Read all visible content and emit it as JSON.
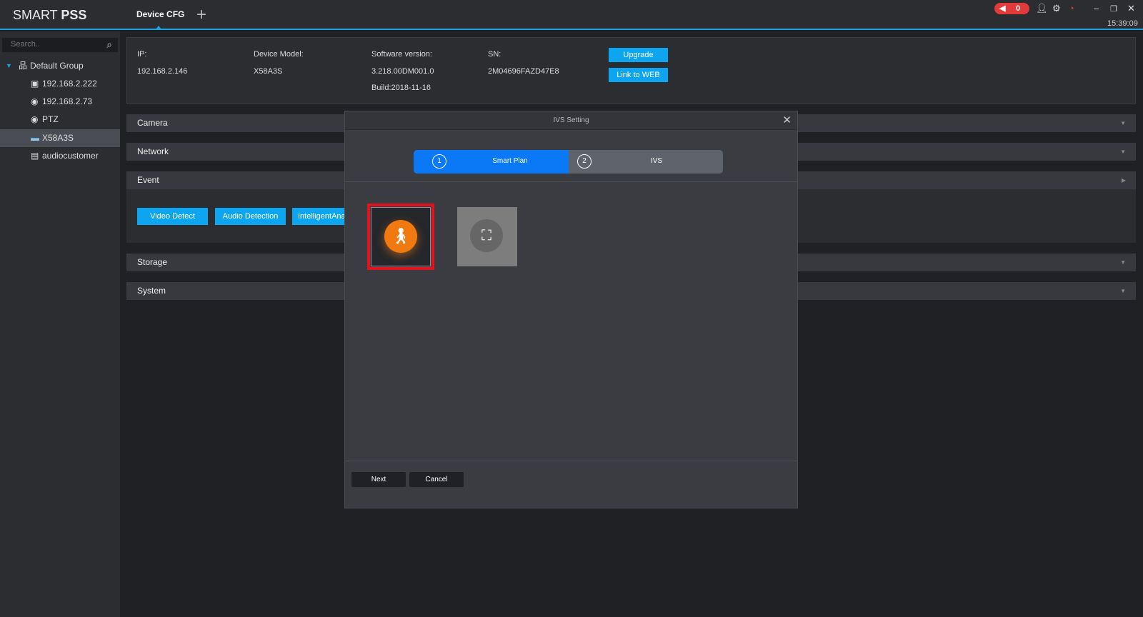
{
  "header": {
    "logo_light": "SMART ",
    "logo_bold": "PSS",
    "active_tab": "Device CFG",
    "add_tab": "+",
    "alarm_count": "0",
    "clock": "15:39:09",
    "icons": [
      "speaker-icon",
      "user-icon",
      "gear-icon",
      "performance-icon",
      "minimize-icon",
      "restore-icon",
      "close-icon"
    ],
    "accent": "#1aa0e0"
  },
  "sidebar": {
    "search_placeholder": "Search..",
    "group": "Default Group",
    "items": [
      {
        "label": "192.168.2.222",
        "icon": "nvr-offline-icon"
      },
      {
        "label": "192.168.2.73",
        "icon": "camera-icon"
      },
      {
        "label": "PTZ",
        "icon": "camera-icon"
      },
      {
        "label": "X58A3S",
        "icon": "device-icon",
        "selected": true
      },
      {
        "label": "audiocustomer",
        "icon": "audio-device-icon"
      }
    ]
  },
  "info": {
    "ip_label": "IP:",
    "ip": "192.168.2.146",
    "model_label": "Device Model:",
    "model": "X58A3S",
    "sw_label": "Software version:",
    "sw": "3.218.00DM001.0",
    "build": "Build:2018-11-16",
    "sn_label": "SN:",
    "sn": "2M04696FAZD47E8",
    "upgrade": "Upgrade",
    "link_web": "Link to WEB"
  },
  "sections": {
    "camera": "Camera",
    "network": "Network",
    "event": "Event",
    "storage": "Storage",
    "system": "System"
  },
  "event_buttons": [
    "Video Detect",
    "Audio Detection",
    "IntelligentAna"
  ],
  "dialog": {
    "title": "IVS Setting",
    "step1_num": "1",
    "step1": "Smart Plan",
    "step2_num": "2",
    "step2": "IVS",
    "next": "Next",
    "cancel": "Cancel",
    "plans": [
      {
        "icon": "people-tracking-icon",
        "selected": true
      },
      {
        "icon": "face-detection-icon",
        "selected": false
      }
    ]
  }
}
